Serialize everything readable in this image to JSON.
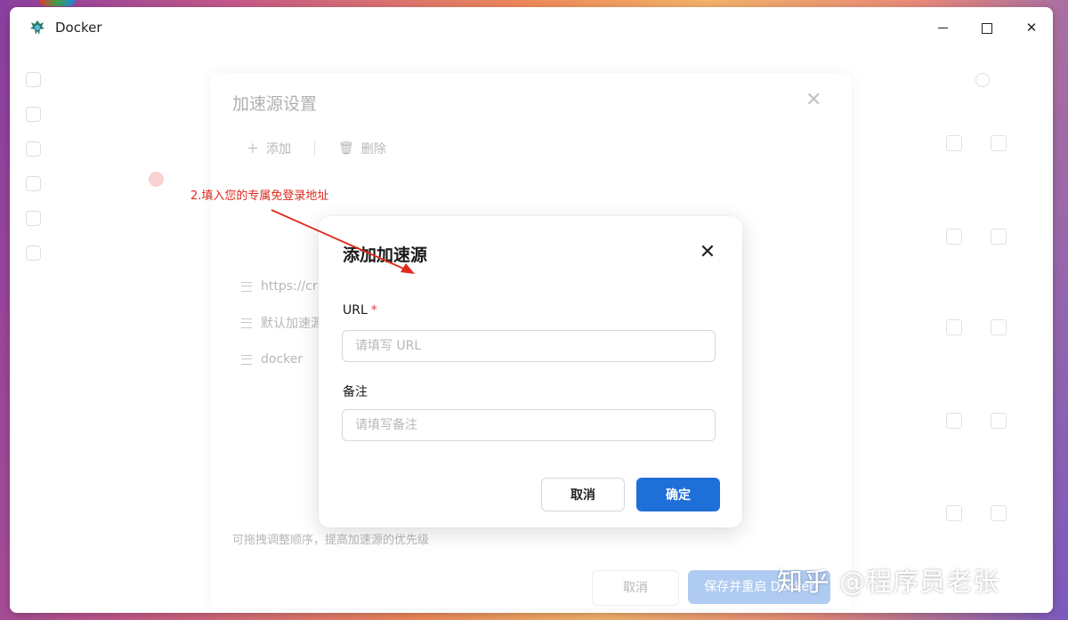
{
  "window": {
    "title": "Docker",
    "icon": "docker-whale-icon",
    "controls": {
      "minimize": "minimize-icon",
      "maximize": "maximize-icon",
      "close": "✕"
    }
  },
  "modal": {
    "title": "添加加速源",
    "close_glyph": "✕",
    "url_label": "URL",
    "required_mark": "*",
    "url_placeholder": "请填写 URL",
    "url_value": "",
    "note_label": "备注",
    "note_placeholder": "请填写备注",
    "note_value": "",
    "cancel_label": "取消",
    "confirm_label": "确定"
  },
  "background_dialog": {
    "title": "加速源设置",
    "close_glyph": "✕",
    "add_label": "添加",
    "delete_label": "删除",
    "rows": [
      "https://cr",
      "默认加速源",
      "docker"
    ],
    "hint": "可拖拽调整顺序，提高加速源的优先级",
    "cancel_label": "取消",
    "save_label": "保存并重启 Docker"
  },
  "annotation": {
    "text": "2.填入您的专属免登录地址",
    "color": "#e0281c"
  },
  "watermark": "知乎 @程序员老张",
  "colors": {
    "primary": "#1f6fd8",
    "required": "#e53935",
    "annotation": "#e0281c"
  }
}
